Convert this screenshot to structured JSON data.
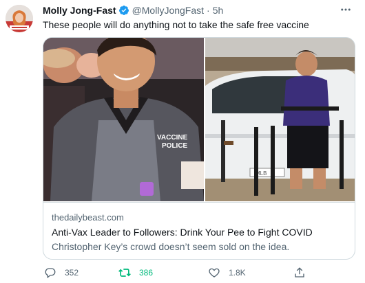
{
  "tweet": {
    "author_name": "Molly Jong-Fast",
    "handle": "@MollyJongFast",
    "separator": "·",
    "time": "5h",
    "text": "These people will do anything not to take the safe free vaccine",
    "more_icon": "more-horizontal-icon",
    "verified_icon": "verified-badge-icon"
  },
  "card": {
    "domain": "thedailybeast.com",
    "title": "Anti-Vax Leader to Followers: Drink Your Pee to Fight COVID",
    "description": "Christopher Key’s crowd doesn’t seem sold on the idea.",
    "image_shirt_text_line1": "VACCINE",
    "image_shirt_text_line2": "POLICE",
    "image_car_plate": "MLB"
  },
  "actions": {
    "reply_count": "352",
    "retweet_count": "386",
    "like_count": "1.8K",
    "reply_icon": "reply-icon",
    "retweet_icon": "retweet-icon",
    "like_icon": "heart-icon",
    "share_icon": "share-icon"
  },
  "colors": {
    "text_primary": "#0f1419",
    "text_secondary": "#536471",
    "verified_blue": "#1d9bf0",
    "retweet_green": "#00ba7c",
    "border": "#cfd9de"
  }
}
